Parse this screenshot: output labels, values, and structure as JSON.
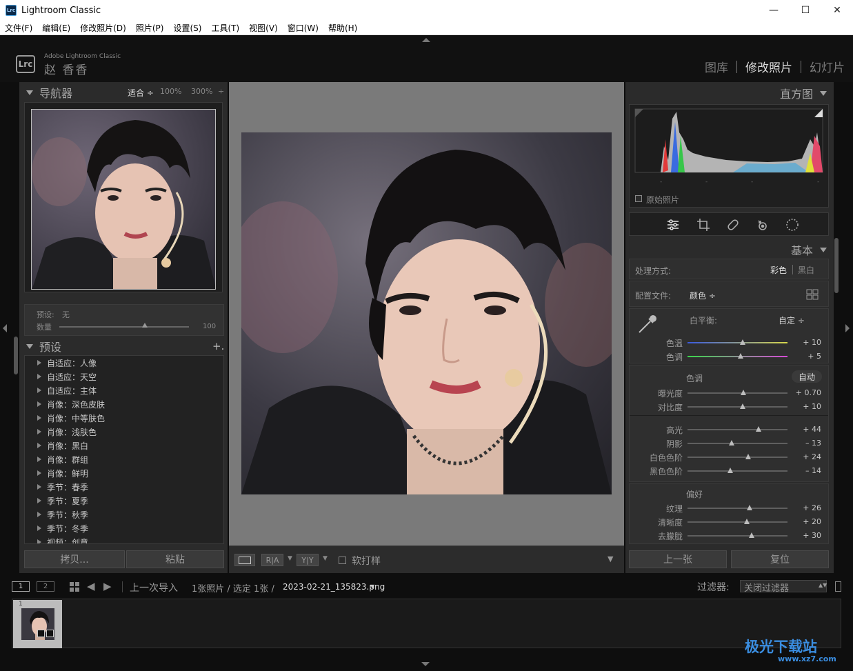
{
  "window": {
    "title": "Lightroom Classic",
    "icon_text": "Lrc",
    "minimize": "—",
    "maximize": "☐",
    "close": "✕"
  },
  "menu": [
    "文件(F)",
    "编辑(E)",
    "修改照片(D)",
    "照片(P)",
    "设置(S)",
    "工具(T)",
    "视图(V)",
    "窗口(W)",
    "帮助(H)"
  ],
  "identity": {
    "badge": "Lrc",
    "product": "Adobe Lightroom Classic",
    "user": "赵 香香"
  },
  "modules": {
    "library": "图库",
    "develop": "修改照片",
    "slideshow": "幻灯片"
  },
  "navigator": {
    "title": "导航器",
    "fit": "适合 ÷",
    "z100": "100%",
    "z300": "300%",
    "more": "÷"
  },
  "preset_amount": {
    "preset_label": "预设:",
    "preset_value": "无",
    "amount_label": "数量",
    "amount_value": "100",
    "amount": 0.66
  },
  "presets": {
    "title": "预设",
    "add": "+.",
    "items": [
      "自适应：人像",
      "自适应：天空",
      "自适应：主体",
      "肖像：深色皮肤",
      "肖像：中等肤色",
      "肖像：浅肤色",
      "肖像：黑白",
      "肖像：群组",
      "肖像：鲜明",
      "季节：春季",
      "季节：夏季",
      "季节：秋季",
      "季节：冬季",
      "视频：创意"
    ]
  },
  "left_buttons": {
    "copy": "拷贝...",
    "paste": "粘贴"
  },
  "toolbar": {
    "ra": "R|A",
    "yy": "Y|Y",
    "softproof": "软打样"
  },
  "histogram": {
    "title": "直方图",
    "original": "原始照片"
  },
  "basic": {
    "title": "基本",
    "treatment_label": "处理方式:",
    "color": "彩色",
    "bw": "黑白",
    "profile_label": "配置文件:",
    "profile_value": "颜色 ÷",
    "wb_label": "白平衡:",
    "wb_value": "自定 ÷",
    "tone_label": "色调",
    "auto": "自动",
    "presence_label": "偏好"
  },
  "sliders": [
    {
      "name": "色温",
      "value": "+ 10",
      "pos": 0.55
    },
    {
      "name": "色调",
      "value": "+ 5",
      "pos": 0.53
    },
    {
      "name": "曝光度",
      "value": "+ 0.70",
      "pos": 0.56
    },
    {
      "name": "对比度",
      "value": "+ 10",
      "pos": 0.55
    },
    {
      "name": "高光",
      "value": "+ 44",
      "pos": 0.71
    },
    {
      "name": "阴影",
      "value": "– 13",
      "pos": 0.44
    },
    {
      "name": "白色色阶",
      "value": "+ 24",
      "pos": 0.61
    },
    {
      "name": "黑色色阶",
      "value": "– 14",
      "pos": 0.43
    },
    {
      "name": "纹理",
      "value": "+ 26",
      "pos": 0.62
    },
    {
      "name": "清晰度",
      "value": "+ 20",
      "pos": 0.59
    },
    {
      "name": "去朦胧",
      "value": "+ 30",
      "pos": 0.64
    }
  ],
  "right_buttons": {
    "prev": "上一张",
    "reset": "复位"
  },
  "filmstrip": {
    "screen1": "1",
    "screen2": "2",
    "source": "上一次导入",
    "count": "1张照片 / 选定 1张 /",
    "filename": "2023-02-21_135823.png",
    "filter_label": "过滤器:",
    "filter_value": "关闭过滤器",
    "thumb_index": "1"
  },
  "watermark": {
    "name": "极光下载站",
    "url": "www.xz7.com"
  },
  "colors": {
    "accent": "#3a8de0",
    "panel": "#2b2b2b",
    "canvas": "#7a7a7a"
  }
}
